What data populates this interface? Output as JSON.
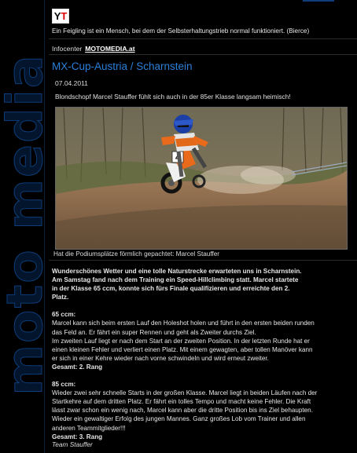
{
  "sidebar": {
    "brand_text": "moto media"
  },
  "header": {
    "logo_text_y": "Y",
    "logo_text_t": "T",
    "quote": "Ein Feigling ist ein Mensch, bei dem der Selbsterhaltungstrieb normal funktioniert. (Bierce)"
  },
  "nav": {
    "label": "Infocenter",
    "link": "MOTOMEDIA.at"
  },
  "article": {
    "title": "MX-Cup-Austria / Scharnstein",
    "date": "07.04.2011",
    "lead": "Blondschopf Marcel Stauffer fühlt sich auch in der 85er Klasse langsam heimisch!",
    "image_caption": "Hat die Podiumsplätze förmlich gepachtet: Marcel Stauffer",
    "rider_number": "4",
    "intro_line1": "Wunderschönes Wetter und eine tolle Naturstrecke erwarteten uns in Scharnstein.",
    "intro_line2": "Am Samstag fand nach dem Training ein Speed-Hillclimbing statt. Marcel startete",
    "intro_line3": "in der Klasse 65 ccm, konnte sich fürs Finale qualifizieren und erreichte den 2.",
    "intro_line4": "Platz.",
    "s65_heading": "65 ccm:",
    "s65_line1": "Marcel kann sich beim ersten Lauf den Holeshot holen und führt in den ersten beiden runden",
    "s65_line2": "das Feld an. Er fährt ein super Rennen und geht als Zweiter durchs Ziel.",
    "s65_line3": "Im zweiten Lauf liegt er nach dem Start an der zweiten Position. In der letzten Runde hat er",
    "s65_line4": "einen kleinen Fehler und verliert einen Platz. Mit einem gewagten, aber tollen Manöver kann",
    "s65_line5": "er sich in einer Kehre wieder nach vorne schwindeln und wird erneut zweiter.",
    "s65_result": "Gesamt: 2. Rang",
    "s85_heading": "85 ccm:",
    "s85_line1": "Wieder zwei sehr schnelle Starts in der großen Klasse. Marcel liegt in beiden Läufen nach der",
    "s85_line2": "Startkehre auf dem dritten Platz. Er fährt ein tolles Tempo und macht keine Fehler. Die Kraft",
    "s85_line3": "lässt zwar schon ein wenig nach, Marcel kann aber die dritte Position bis ins Ziel behaupten.",
    "s85_line4": "Wieder ein gewaltiger Erfolg des jungen Mannes. Ganz großes Lob vom Trainer und allen",
    "s85_line5": "anderen Teammitglieder!!!",
    "s85_result": "Gesamt: 3. Rang",
    "signature": "Team Stauffer"
  }
}
